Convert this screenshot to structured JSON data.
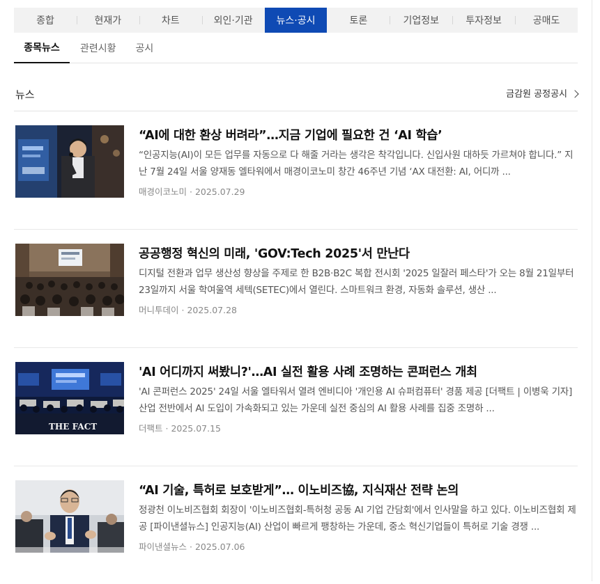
{
  "main_tabs": [
    {
      "label": "종합"
    },
    {
      "label": "현재가"
    },
    {
      "label": "차트"
    },
    {
      "label": "외인·기관"
    },
    {
      "label": "뉴스·공시"
    },
    {
      "label": "토론"
    },
    {
      "label": "기업정보"
    },
    {
      "label": "투자정보"
    },
    {
      "label": "공매도"
    }
  ],
  "active_main_tab": "뉴스·공시",
  "sub_tabs": [
    {
      "label": "종목뉴스"
    },
    {
      "label": "관련시황"
    },
    {
      "label": "공시"
    }
  ],
  "section": {
    "title": "뉴스",
    "more_link": "금감원 공정공시"
  },
  "news": [
    {
      "title": "“AI에 대한 환상 버려라”…지금 기업에 필요한 건 ‘AI 학습’",
      "summary": "“인공지능(AI)이 모든 업무를 자동으로 다 해줄 거라는 생각은 착각입니다. 신입사원 대하듯 가르쳐야 합니다.” 지난 7월 24일 서울 양재동 엘타워에서 매경이코노미 창간 46주년 기념 ‘AX 대전환: AI, 어디까 ...",
      "source": "매경이코노미",
      "date": "2025.07.29",
      "thumb_icon": "speaker-at-podium-photo"
    },
    {
      "title": "공공행정 혁신의 미래, 'GOV:Tech 2025'서 만난다",
      "summary": "디지털 전환과 업무 생산성 향상을 주제로 한 B2B·B2C 복합 전시회 '2025 일잘러 페스타'가 오는 8월 21일부터 23일까지 서울 학여울역 세텍(SETEC)에서 열린다. 스마트워크 환경, 자동화 솔루션, 생산 ...",
      "source": "머니투데이",
      "date": "2025.07.28",
      "thumb_icon": "conference-hall-photo"
    },
    {
      "title": "'AI 어디까지 써봤니?'…AI 실전 활용 사례 조명하는 콘퍼런스 개최",
      "summary": "'AI 콘퍼런스 2025' 24일 서울 엘타워서 열려 엔비디아 '개인용 AI 슈퍼컴퓨터' 경품 제공 [더팩트 | 이병욱 기자] 산업 전반에서 AI 도입이 가속화되고 있는 가운데 실전 중심의 AI 활용 사례를 집중 조명하 ...",
      "source": "더팩트",
      "date": "2025.07.15",
      "thumb_icon": "conference-audience-photo",
      "thumb_caption": "THE FACT"
    },
    {
      "title": "“AI 기술, 특허로 보호받게”… 이노비즈協, 지식재산 전략 논의",
      "summary": "정광천 이노비즈협회 회장이 '이노비즈협회-특허청 공동 AI 기업 간담회'에서 인사말을 하고 있다. 이노비즈협회 제공 [파이낸셜뉴스] 인공지능(AI) 산업이 빠르게 팽창하는 가운데, 중소 혁신기업들이 특허로 기술 경쟁 ...",
      "source": "파이낸셜뉴스",
      "date": "2025.07.06",
      "thumb_icon": "man-speaking-photo"
    }
  ]
}
